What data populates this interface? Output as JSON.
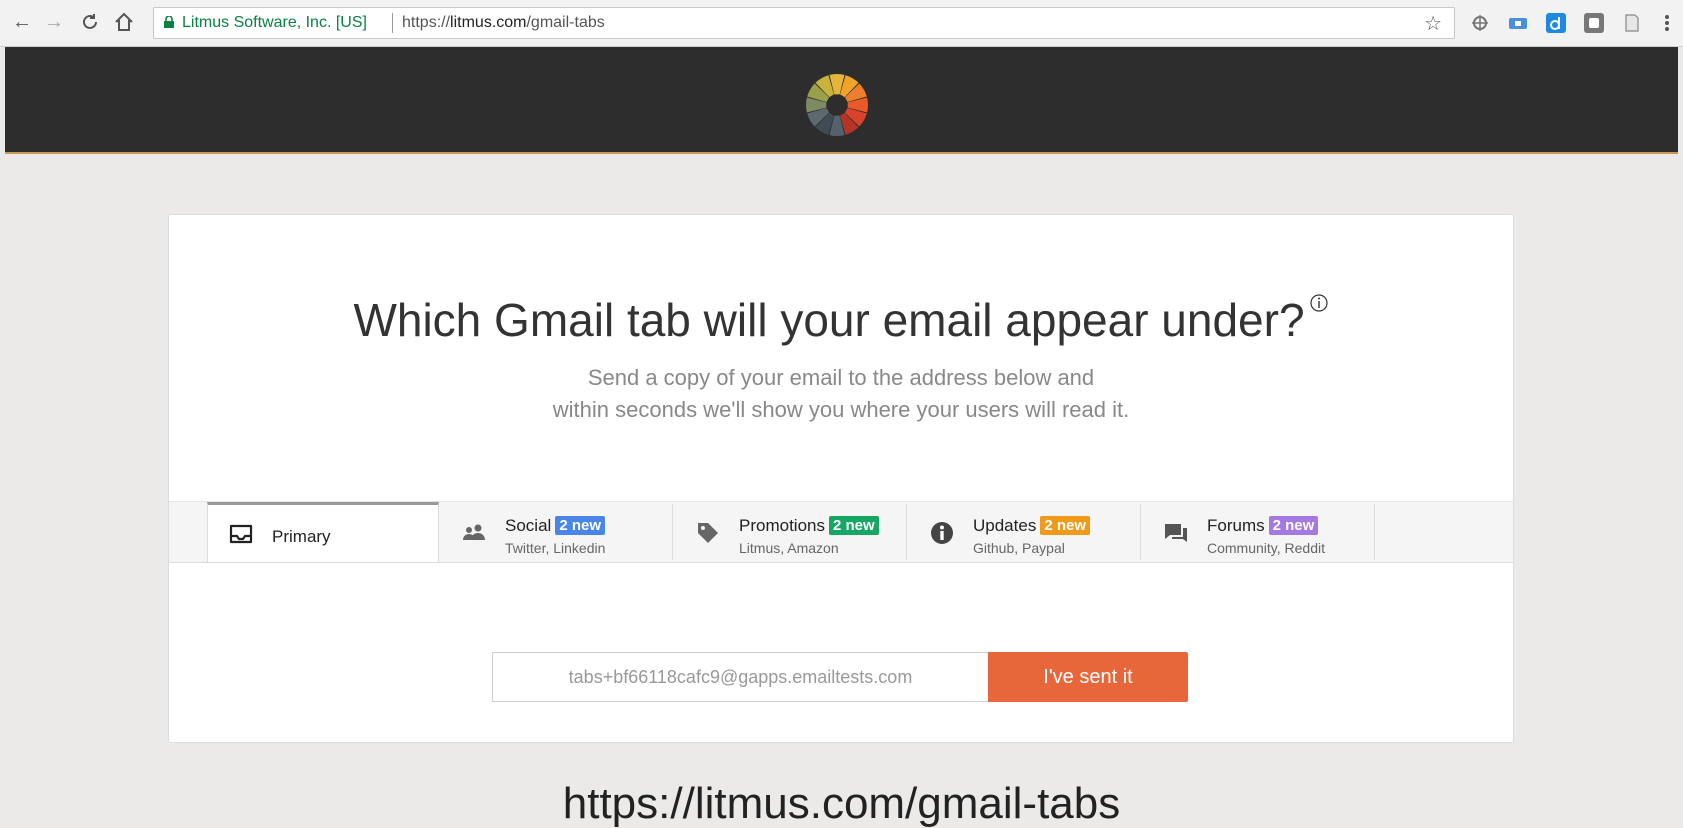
{
  "browser": {
    "secure_label": "Litmus Software, Inc. [US]",
    "url_scheme": "https://",
    "url_host": "litmus.com",
    "url_path": "/gmail-tabs",
    "icons": [
      "back-arrow-icon",
      "forward-arrow-icon",
      "reload-icon",
      "home-icon",
      "lock-icon",
      "star-icon",
      "extension-icons"
    ]
  },
  "header": {
    "logo": "litmus-logo"
  },
  "main": {
    "title": "Which Gmail tab will your email appear under?",
    "subtitle_line1": "Send a copy of your email to the address below and",
    "subtitle_line2": "within seconds we'll show you where your users will read it."
  },
  "tabs": [
    {
      "label": "Primary",
      "badge": "",
      "sub": "",
      "icon": "inbox-icon",
      "badge_color": ""
    },
    {
      "label": "Social",
      "badge": "2 new",
      "sub": "Twitter, Linkedin",
      "icon": "people-icon",
      "badge_color": "#4a86e8"
    },
    {
      "label": "Promotions",
      "badge": "2 new",
      "sub": "Litmus, Amazon",
      "icon": "tag-icon",
      "badge_color": "#16a765"
    },
    {
      "label": "Updates",
      "badge": "2 new",
      "sub": "Github, Paypal",
      "icon": "info-icon",
      "badge_color": "#f09a1a"
    },
    {
      "label": "Forums",
      "badge": "2 new",
      "sub": "Community, Reddit",
      "icon": "forum-icon",
      "badge_color": "#a479e2"
    }
  ],
  "form": {
    "email": "tabs+bf66118cafc9@gapps.emailtests.com",
    "button_label": "I've sent it"
  },
  "footer": {
    "url_text": "https://litmus.com/gmail-tabs"
  },
  "colors": {
    "accent": "#e8673a",
    "header_bg": "#2d2d2d",
    "page_bg": "#ebeae8"
  }
}
